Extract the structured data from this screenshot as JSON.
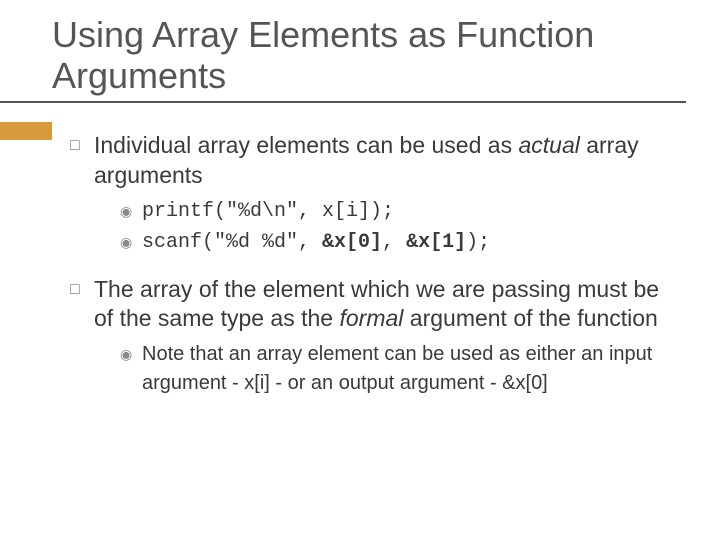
{
  "slide": {
    "title": "Using Array Elements as Function Arguments",
    "points": [
      {
        "text_pre": "Individual array elements can be used as ",
        "text_em": "actual",
        "text_post": " array arguments",
        "sub": [
          {
            "code": "printf(\"%d\\n\", x[i]);"
          },
          {
            "code_pre": "scanf(\"%d %d\", ",
            "code_b1": "&x[0]",
            "code_mid": ", ",
            "code_b2": "&x[1]",
            "code_post": ");"
          }
        ]
      },
      {
        "text_pre": "The array of the element which we are passing must be of the same type as the ",
        "text_em": "formal",
        "text_post": " argument of the function",
        "sub": [
          {
            "note": "Note that an array element can be used as either an input argument - x[i] - or an output argument - &x[0]"
          }
        ]
      }
    ]
  }
}
